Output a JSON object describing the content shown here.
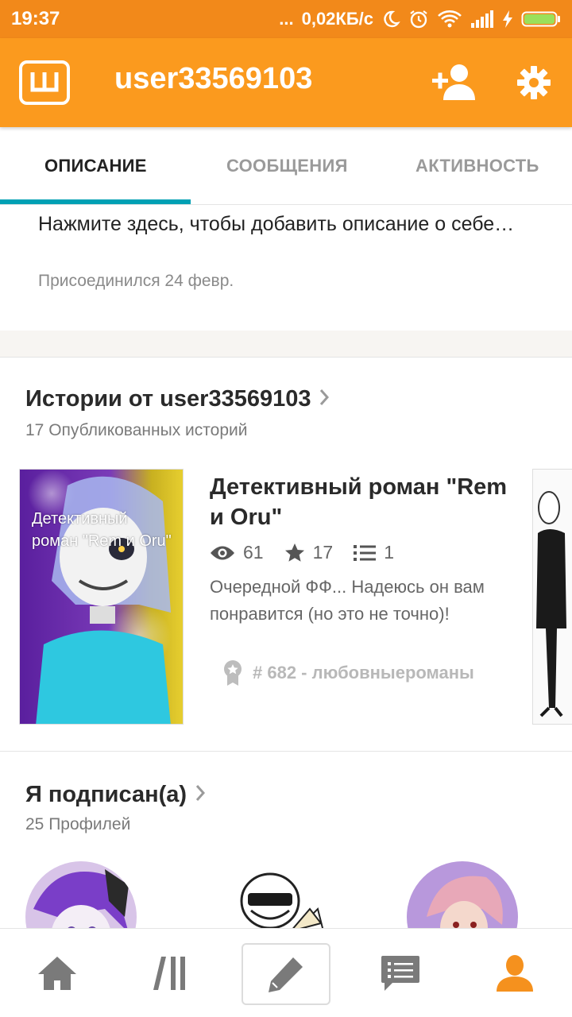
{
  "status_bar": {
    "time": "19:37",
    "dots": "...",
    "network_speed": "0,02КБ/с"
  },
  "header": {
    "username": "user33569103",
    "logo_letter": "Ш"
  },
  "tabs": [
    {
      "label": "ОПИСАНИЕ",
      "active": true
    },
    {
      "label": "СООБЩЕНИЯ",
      "active": false
    },
    {
      "label": "АКТИВНОСТЬ",
      "active": false
    }
  ],
  "about": {
    "description_placeholder": "Нажмите здесь, чтобы добавить описание о себе…",
    "joined": "Присоединился 24 февр."
  },
  "stories": {
    "title": "Истории от user33569103",
    "subtitle": "17 Опубликованных историй",
    "items": [
      {
        "cover_text": "Детективный роман \"Rem и Oru\"",
        "title": "Детективный роман \"Rem и Oru\"",
        "views": "61",
        "votes": "17",
        "parts": "1",
        "description": "Очередной ФФ... Надеюсь он вам понравится (но это не точно)!",
        "rank": "# 682 - любовныероманы"
      }
    ]
  },
  "following": {
    "title": "Я подписан(а)",
    "subtitle": "25 Профилей"
  },
  "bottom_nav": [
    "home",
    "library",
    "write",
    "messages",
    "profile"
  ],
  "colors": {
    "accent": "#fb9a1e",
    "status_bar": "#f2891a",
    "tab_indicator": "#00a0b4",
    "active_nav": "#f5911e"
  }
}
